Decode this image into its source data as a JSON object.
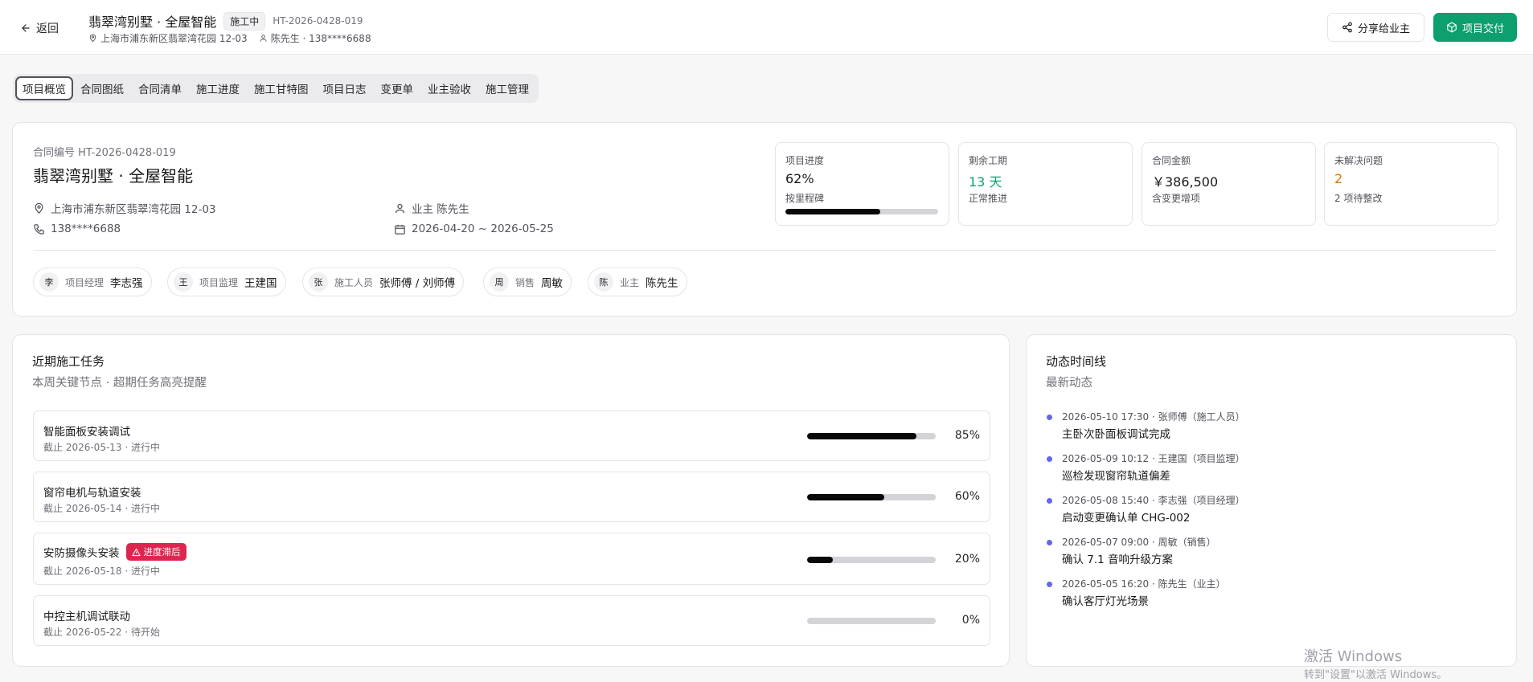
{
  "header": {
    "back_label": "返回",
    "title": "翡翠湾别墅 · 全屋智能",
    "status": "施工中",
    "code": "HT-2026-0428-019",
    "address": "上海市浦东新区翡翠湾花园 12-03",
    "owner_contact": "陈先生 · 138****6688",
    "share_label": "分享给业主",
    "deliver_label": "项目交付",
    "accent": "#0e9f6e"
  },
  "tabs": [
    {
      "label": "项目概览",
      "active": true
    },
    {
      "label": "合同图纸"
    },
    {
      "label": "合同清单"
    },
    {
      "label": "施工进度"
    },
    {
      "label": "施工甘特图"
    },
    {
      "label": "项目日志"
    },
    {
      "label": "变更单"
    },
    {
      "label": "业主验收"
    },
    {
      "label": "施工管理"
    }
  ],
  "summary": {
    "contract_no": "合同编号 HT-2026-0428-019",
    "title": "翡翠湾别墅 · 全屋智能",
    "address": "上海市浦东新区翡翠湾花园 12-03",
    "phone": "138****6688",
    "owner": "业主 陈先生",
    "dates": "2026-04-20 ~ 2026-05-25",
    "stats": [
      {
        "label": "项目进度",
        "value": "62%",
        "hint": "按里程碑",
        "progress": 62,
        "color": "#18181b"
      },
      {
        "label": "剩余工期",
        "value": "13 天",
        "hint": "正常推进",
        "color": "#0e9f6e"
      },
      {
        "label": "合同金额",
        "value": "￥386,500",
        "hint": "含变更增项",
        "color": "#18181b"
      },
      {
        "label": "未解决问题",
        "value": "2",
        "hint": "2 项待整改",
        "color": "#d97706"
      }
    ],
    "team": [
      {
        "avatar": "李",
        "role": "项目经理",
        "name": "李志强"
      },
      {
        "avatar": "王",
        "role": "项目监理",
        "name": "王建国"
      },
      {
        "avatar": "张",
        "role": "施工人员",
        "name": "张师傅 / 刘师傅"
      },
      {
        "avatar": "周",
        "role": "销售",
        "name": "周敏"
      },
      {
        "avatar": "陈",
        "role": "业主",
        "name": "陈先生"
      }
    ]
  },
  "tasks": {
    "title": "近期施工任务",
    "subtitle": "本周关键节点 · 超期任务高亮提醒",
    "late_label": "进度滞后",
    "items": [
      {
        "name": "智能面板安装调试",
        "meta": "截止 2026-05-13 · 进行中",
        "progress": 85,
        "pct": "85%"
      },
      {
        "name": "窗帘电机与轨道安装",
        "meta": "截止 2026-05-14 · 进行中",
        "progress": 60,
        "pct": "60%"
      },
      {
        "name": "安防摄像头安装",
        "meta": "截止 2026-05-18 · 进行中",
        "progress": 20,
        "pct": "20%",
        "late": true
      },
      {
        "name": "中控主机调试联动",
        "meta": "截止 2026-05-22 · 待开始",
        "progress": 0,
        "pct": "0%"
      }
    ]
  },
  "timeline": {
    "title": "动态时间线",
    "subtitle": "最新动态",
    "items": [
      {
        "time": "2026-05-10 17:30 · 张师傅（施工人员）",
        "text": "主卧次卧面板调试完成"
      },
      {
        "time": "2026-05-09 10:12 · 王建国（项目监理）",
        "text": "巡检发现窗帘轨道偏差"
      },
      {
        "time": "2026-05-08 15:40 · 李志强（项目经理）",
        "text": "启动变更确认单 CHG-002"
      },
      {
        "time": "2026-05-07 09:00 · 周敏（销售）",
        "text": "确认 7.1 音响升级方案"
      },
      {
        "time": "2026-05-05 16:20 · 陈先生（业主）",
        "text": "确认客厅灯光场景"
      }
    ]
  },
  "watermark": {
    "line1": "激活 Windows",
    "line2": "转到\"设置\"以激活 Windows。"
  }
}
